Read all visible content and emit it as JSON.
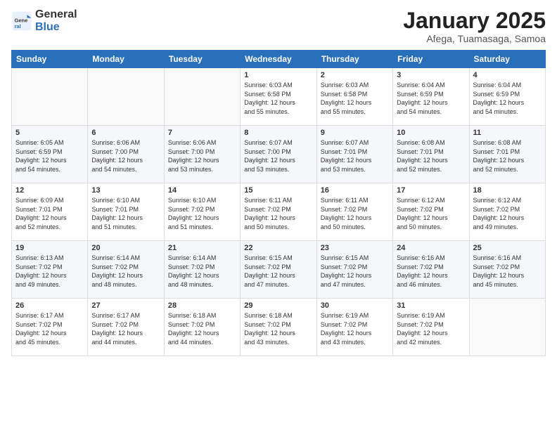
{
  "logo": {
    "general": "General",
    "blue": "Blue"
  },
  "title": "January 2025",
  "subtitle": "Afega, Tuamasaga, Samoa",
  "weekdays": [
    "Sunday",
    "Monday",
    "Tuesday",
    "Wednesday",
    "Thursday",
    "Friday",
    "Saturday"
  ],
  "weeks": [
    [
      {
        "day": "",
        "info": ""
      },
      {
        "day": "",
        "info": ""
      },
      {
        "day": "",
        "info": ""
      },
      {
        "day": "1",
        "info": "Sunrise: 6:03 AM\nSunset: 6:58 PM\nDaylight: 12 hours\nand 55 minutes."
      },
      {
        "day": "2",
        "info": "Sunrise: 6:03 AM\nSunset: 6:58 PM\nDaylight: 12 hours\nand 55 minutes."
      },
      {
        "day": "3",
        "info": "Sunrise: 6:04 AM\nSunset: 6:59 PM\nDaylight: 12 hours\nand 54 minutes."
      },
      {
        "day": "4",
        "info": "Sunrise: 6:04 AM\nSunset: 6:59 PM\nDaylight: 12 hours\nand 54 minutes."
      }
    ],
    [
      {
        "day": "5",
        "info": "Sunrise: 6:05 AM\nSunset: 6:59 PM\nDaylight: 12 hours\nand 54 minutes."
      },
      {
        "day": "6",
        "info": "Sunrise: 6:06 AM\nSunset: 7:00 PM\nDaylight: 12 hours\nand 54 minutes."
      },
      {
        "day": "7",
        "info": "Sunrise: 6:06 AM\nSunset: 7:00 PM\nDaylight: 12 hours\nand 53 minutes."
      },
      {
        "day": "8",
        "info": "Sunrise: 6:07 AM\nSunset: 7:00 PM\nDaylight: 12 hours\nand 53 minutes."
      },
      {
        "day": "9",
        "info": "Sunrise: 6:07 AM\nSunset: 7:01 PM\nDaylight: 12 hours\nand 53 minutes."
      },
      {
        "day": "10",
        "info": "Sunrise: 6:08 AM\nSunset: 7:01 PM\nDaylight: 12 hours\nand 52 minutes."
      },
      {
        "day": "11",
        "info": "Sunrise: 6:08 AM\nSunset: 7:01 PM\nDaylight: 12 hours\nand 52 minutes."
      }
    ],
    [
      {
        "day": "12",
        "info": "Sunrise: 6:09 AM\nSunset: 7:01 PM\nDaylight: 12 hours\nand 52 minutes."
      },
      {
        "day": "13",
        "info": "Sunrise: 6:10 AM\nSunset: 7:01 PM\nDaylight: 12 hours\nand 51 minutes."
      },
      {
        "day": "14",
        "info": "Sunrise: 6:10 AM\nSunset: 7:02 PM\nDaylight: 12 hours\nand 51 minutes."
      },
      {
        "day": "15",
        "info": "Sunrise: 6:11 AM\nSunset: 7:02 PM\nDaylight: 12 hours\nand 50 minutes."
      },
      {
        "day": "16",
        "info": "Sunrise: 6:11 AM\nSunset: 7:02 PM\nDaylight: 12 hours\nand 50 minutes."
      },
      {
        "day": "17",
        "info": "Sunrise: 6:12 AM\nSunset: 7:02 PM\nDaylight: 12 hours\nand 50 minutes."
      },
      {
        "day": "18",
        "info": "Sunrise: 6:12 AM\nSunset: 7:02 PM\nDaylight: 12 hours\nand 49 minutes."
      }
    ],
    [
      {
        "day": "19",
        "info": "Sunrise: 6:13 AM\nSunset: 7:02 PM\nDaylight: 12 hours\nand 49 minutes."
      },
      {
        "day": "20",
        "info": "Sunrise: 6:14 AM\nSunset: 7:02 PM\nDaylight: 12 hours\nand 48 minutes."
      },
      {
        "day": "21",
        "info": "Sunrise: 6:14 AM\nSunset: 7:02 PM\nDaylight: 12 hours\nand 48 minutes."
      },
      {
        "day": "22",
        "info": "Sunrise: 6:15 AM\nSunset: 7:02 PM\nDaylight: 12 hours\nand 47 minutes."
      },
      {
        "day": "23",
        "info": "Sunrise: 6:15 AM\nSunset: 7:02 PM\nDaylight: 12 hours\nand 47 minutes."
      },
      {
        "day": "24",
        "info": "Sunrise: 6:16 AM\nSunset: 7:02 PM\nDaylight: 12 hours\nand 46 minutes."
      },
      {
        "day": "25",
        "info": "Sunrise: 6:16 AM\nSunset: 7:02 PM\nDaylight: 12 hours\nand 45 minutes."
      }
    ],
    [
      {
        "day": "26",
        "info": "Sunrise: 6:17 AM\nSunset: 7:02 PM\nDaylight: 12 hours\nand 45 minutes."
      },
      {
        "day": "27",
        "info": "Sunrise: 6:17 AM\nSunset: 7:02 PM\nDaylight: 12 hours\nand 44 minutes."
      },
      {
        "day": "28",
        "info": "Sunrise: 6:18 AM\nSunset: 7:02 PM\nDaylight: 12 hours\nand 44 minutes."
      },
      {
        "day": "29",
        "info": "Sunrise: 6:18 AM\nSunset: 7:02 PM\nDaylight: 12 hours\nand 43 minutes."
      },
      {
        "day": "30",
        "info": "Sunrise: 6:19 AM\nSunset: 7:02 PM\nDaylight: 12 hours\nand 43 minutes."
      },
      {
        "day": "31",
        "info": "Sunrise: 6:19 AM\nSunset: 7:02 PM\nDaylight: 12 hours\nand 42 minutes."
      },
      {
        "day": "",
        "info": ""
      }
    ]
  ]
}
